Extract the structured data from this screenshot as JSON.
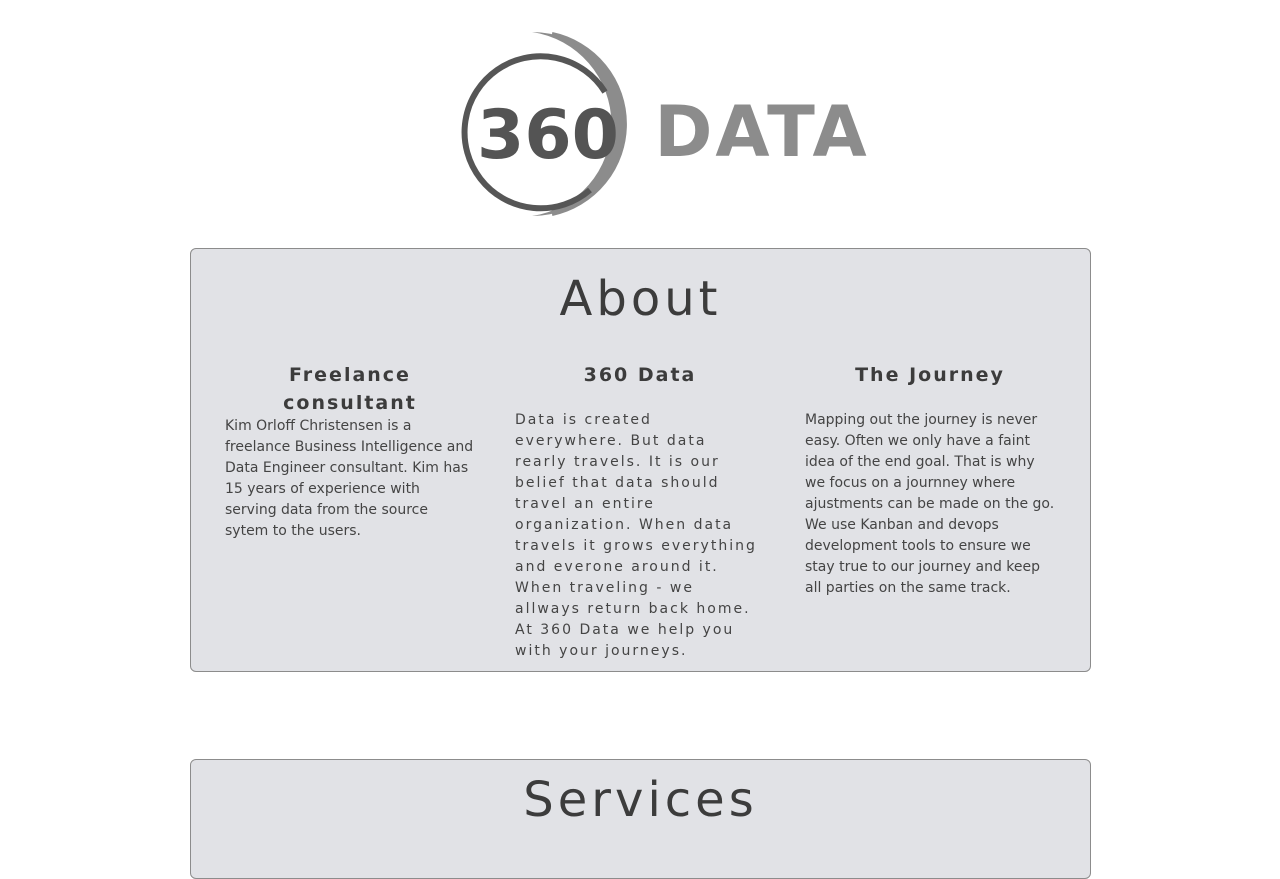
{
  "logo": {
    "number": "360",
    "word": "DATA",
    "colors": {
      "ring_dark": "#565656",
      "ring_light": "#8c8c8c",
      "word": "#8c8c8c",
      "number": "#545454"
    }
  },
  "about": {
    "title": "About",
    "columns": [
      {
        "title": "Freelance consultant",
        "text": "Kim Orloff Christensen is a freelance Business Intelligence and Data Engineer consultant. Kim has 15 years of experience with serving data from the source sytem to the users."
      },
      {
        "title": "360 Data",
        "text": "Data is created everywhere. But data rearly travels. It is our belief that data should travel an entire organization. When data travels it grows everything and everone around it. When traveling - we allways return back home. At 360 Data we help you with your journeys."
      },
      {
        "title": "The Journey",
        "text": "Mapping out the journey is never easy. Often we only have a faint idea of the end goal. That is why we focus on a journney where ajustments can be made on the go. We use Kanban and devops development tools to ensure we stay true to our journey and keep all parties on the same track."
      }
    ]
  },
  "services": {
    "title": "Services"
  },
  "colors": {
    "card_background": "#e1e2e6",
    "card_border": "#8c8c8c",
    "page_background": "#ffffff"
  }
}
